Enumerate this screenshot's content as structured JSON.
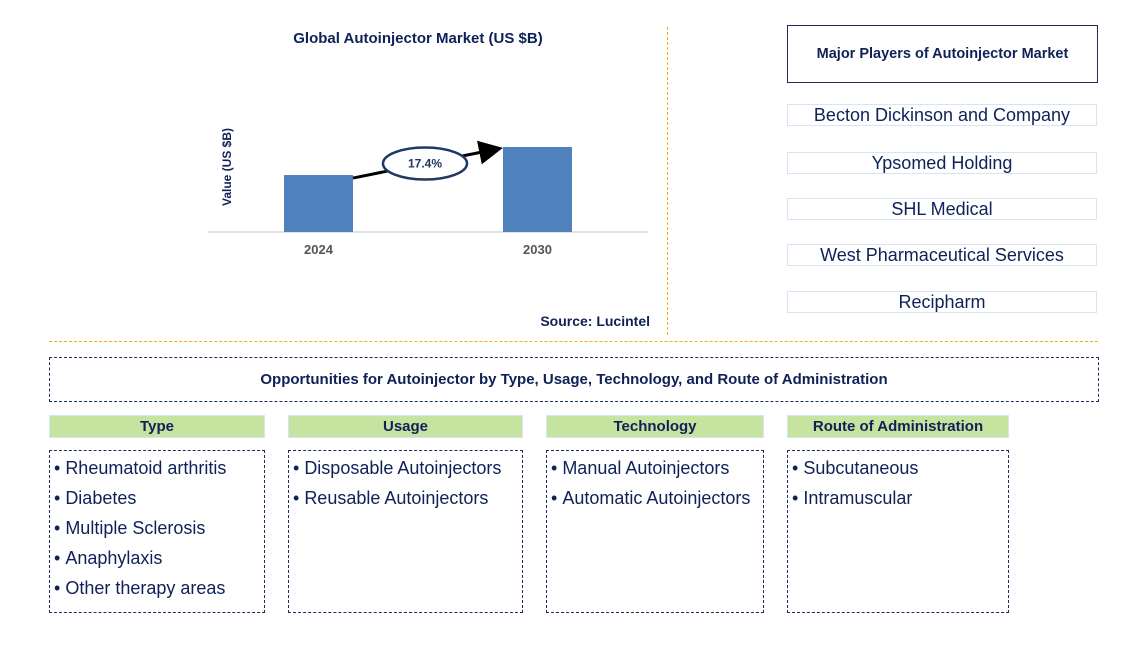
{
  "chart_data": {
    "type": "bar",
    "title": "Global Autoinjector Market (US $B)",
    "xlabel": "",
    "ylabel": "Value (US $B)",
    "categories": [
      "2024",
      "2030"
    ],
    "values": [
      0.67,
      1.0
    ],
    "values_note": "relative bar heights; no numeric axis shown",
    "ylim": [
      0,
      1.2
    ],
    "grid": false,
    "annotation": {
      "label": "17.4%",
      "meaning": "CAGR 2024-2030",
      "shape": "ellipse-with-arrow"
    },
    "bar_color": "#4f81bd",
    "source": "Source: Lucintel"
  },
  "players": {
    "title": "Major Players of Autoinjector Market",
    "items": [
      "Becton Dickinson and Company",
      "Ypsomed Holding",
      "SHL Medical",
      "West Pharmaceutical Services",
      "Recipharm"
    ]
  },
  "opportunities": {
    "title": "Opportunities for Autoinjector by Type, Usage, Technology, and Route of Administration",
    "header_color": "#c6e3a0",
    "categories": [
      {
        "label": "Type",
        "items": [
          "Rheumatoid arthritis",
          "Diabetes",
          "Multiple Sclerosis",
          "Anaphylaxis",
          "Other therapy areas"
        ]
      },
      {
        "label": "Usage",
        "items": [
          "Disposable Autoinjectors",
          "Reusable Autoinjectors"
        ]
      },
      {
        "label": "Technology",
        "items": [
          "Manual Autoinjectors",
          "Automatic Autoinjectors"
        ]
      },
      {
        "label": "Route of Administration",
        "items": [
          "Subcutaneous",
          "Intramuscular"
        ]
      }
    ]
  }
}
